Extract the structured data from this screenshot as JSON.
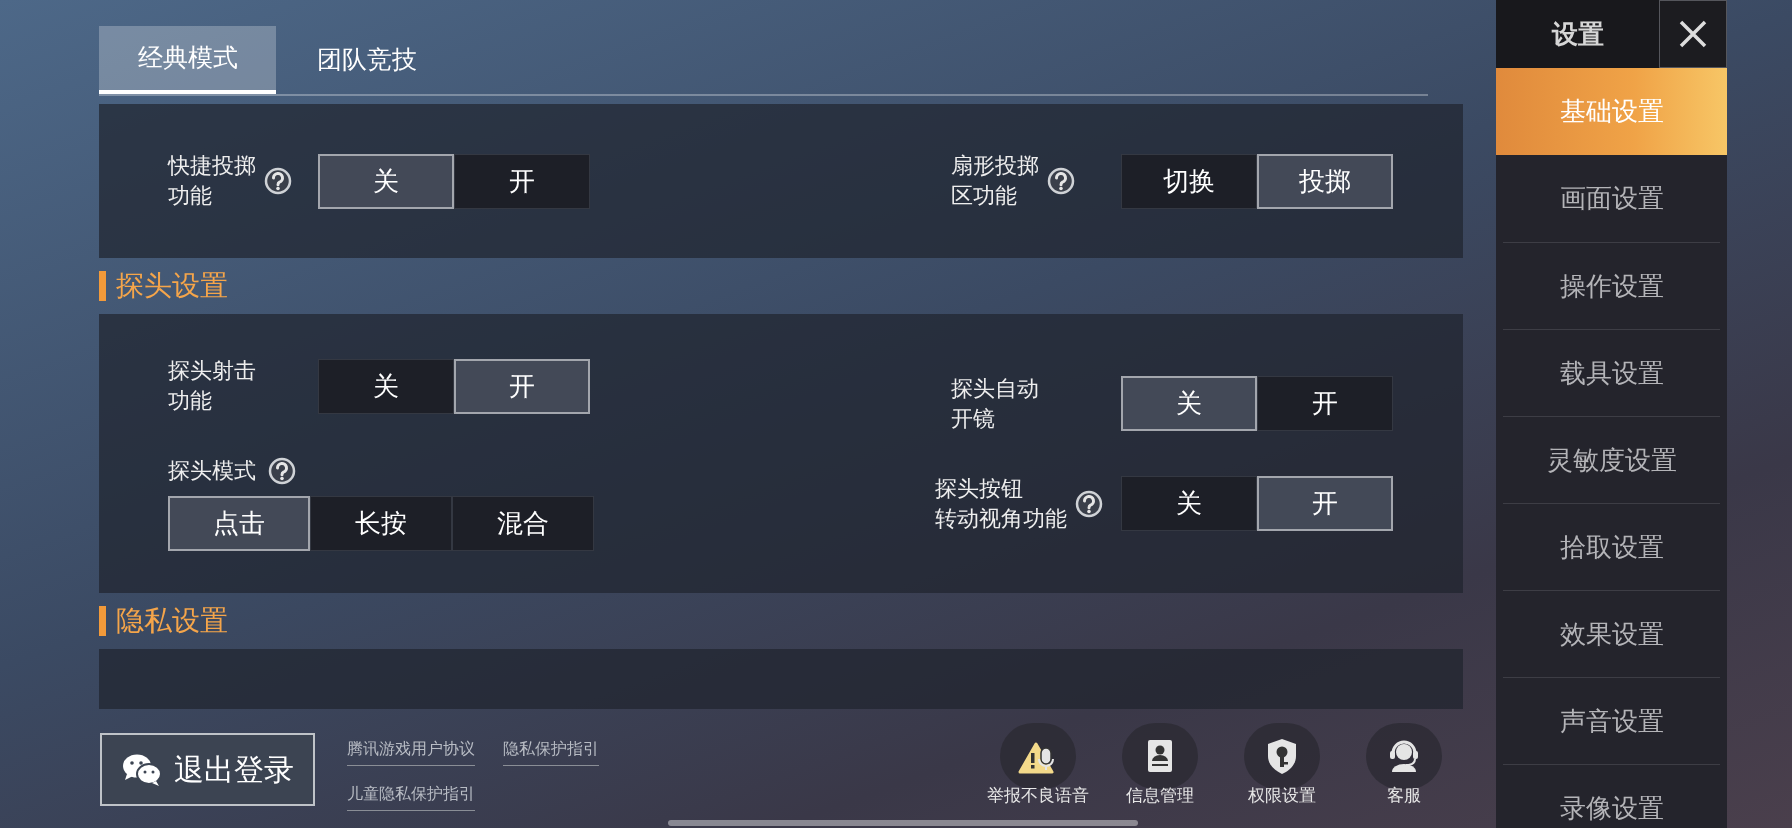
{
  "tabs": [
    {
      "label": "经典模式",
      "selected": true
    },
    {
      "label": "团队竞技",
      "selected": false
    }
  ],
  "sections": [
    {
      "left": [
        {
          "kind": "inline",
          "label_lines": [
            "快捷投掷",
            "功能"
          ],
          "help": true,
          "options": [
            {
              "label": "关",
              "selected": true
            },
            {
              "label": "开",
              "selected": false
            }
          ]
        }
      ],
      "right": [
        {
          "kind": "inline",
          "label_lines": [
            "扇形投掷",
            "区功能"
          ],
          "help": true,
          "options": [
            {
              "label": "切换",
              "selected": false
            },
            {
              "label": "投掷",
              "selected": true
            }
          ]
        }
      ]
    },
    {
      "title": "探头设置",
      "left": [
        {
          "kind": "inline",
          "label_lines": [
            "探头射击",
            "功能"
          ],
          "help": false,
          "options": [
            {
              "label": "关",
              "selected": false
            },
            {
              "label": "开",
              "selected": true
            }
          ]
        },
        {
          "kind": "stacked",
          "label_lines": [
            "探头模式"
          ],
          "help": true,
          "options": [
            {
              "label": "点击",
              "selected": true
            },
            {
              "label": "长按",
              "selected": false
            },
            {
              "label": "混合",
              "selected": false
            }
          ]
        }
      ],
      "right": [
        {
          "kind": "inline",
          "label_lines": [
            "探头自动",
            "开镜"
          ],
          "help": false,
          "options": [
            {
              "label": "关",
              "selected": true
            },
            {
              "label": "开",
              "selected": false
            }
          ]
        },
        {
          "kind": "inline",
          "label_lines": [
            "探头按钮",
            "转动视角功能"
          ],
          "help": true,
          "options": [
            {
              "label": "关",
              "selected": false
            },
            {
              "label": "开",
              "selected": true
            }
          ]
        }
      ]
    },
    {
      "title": "隐私设置"
    }
  ],
  "bottom": {
    "logout": "退出登录",
    "links": [
      "腾讯游戏用户协议",
      "隐私保护指引",
      "儿童隐私保护指引"
    ],
    "actions": [
      {
        "kind": "report",
        "label": "举报不良语音"
      },
      {
        "kind": "info",
        "label": "信息管理"
      },
      {
        "kind": "permission",
        "label": "权限设置"
      },
      {
        "kind": "service",
        "label": "客服"
      }
    ]
  },
  "sidebar": {
    "title": "设置",
    "items": [
      {
        "label": "基础设置",
        "selected": true
      },
      {
        "label": "画面设置",
        "selected": false
      },
      {
        "label": "操作设置",
        "selected": false
      },
      {
        "label": "载具设置",
        "selected": false
      },
      {
        "label": "灵敏度设置",
        "selected": false
      },
      {
        "label": "拾取设置",
        "selected": false
      },
      {
        "label": "效果设置",
        "selected": false
      },
      {
        "label": "声音设置",
        "selected": false
      },
      {
        "label": "录像设置",
        "selected": false
      }
    ]
  }
}
